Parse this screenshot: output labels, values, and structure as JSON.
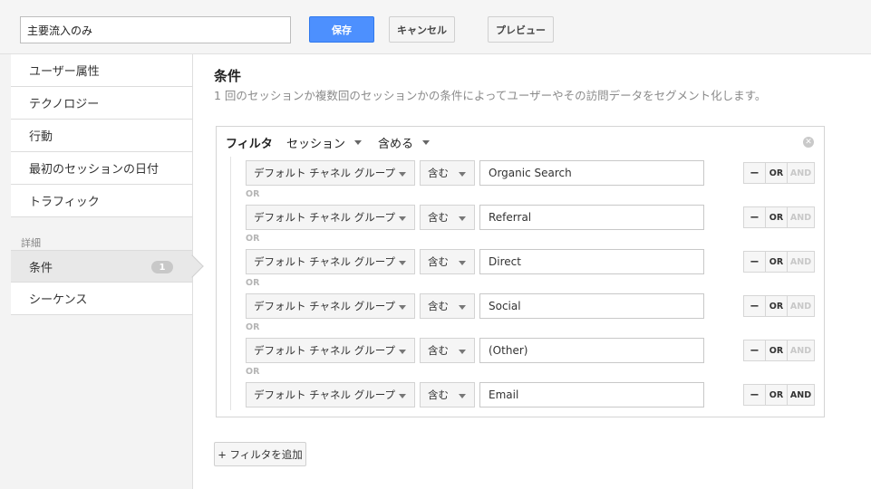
{
  "header": {
    "segment_name": "主要流入のみ",
    "save_label": "保存",
    "cancel_label": "キャンセル",
    "preview_label": "プレビュー"
  },
  "sidebar": {
    "items": [
      {
        "label": "ユーザー属性"
      },
      {
        "label": "テクノロジー"
      },
      {
        "label": "行動"
      },
      {
        "label": "最初のセッションの日付"
      },
      {
        "label": "トラフィック"
      }
    ],
    "section_label": "詳細",
    "advanced": [
      {
        "label": "条件",
        "badge": "1",
        "active": true
      },
      {
        "label": "シーケンス"
      }
    ]
  },
  "main": {
    "title": "条件",
    "description": "1 回のセッションか複数回のセッションかの条件によってユーザーやその訪問データをセグメント化します。",
    "filter": {
      "label": "フィルタ",
      "scope": "セッション",
      "mode": "含める",
      "or_separator": "OR",
      "rows": [
        {
          "dimension": "デフォルト チャネル グループ",
          "operator": "含む",
          "value": "Organic Search",
          "and_active": false
        },
        {
          "dimension": "デフォルト チャネル グループ",
          "operator": "含む",
          "value": "Referral",
          "and_active": false
        },
        {
          "dimension": "デフォルト チャネル グループ",
          "operator": "含む",
          "value": "Direct",
          "and_active": false
        },
        {
          "dimension": "デフォルト チャネル グループ",
          "operator": "含む",
          "value": "Social",
          "and_active": false
        },
        {
          "dimension": "デフォルト チャネル グループ",
          "operator": "含む",
          "value": "(Other)",
          "and_active": false
        },
        {
          "dimension": "デフォルト チャネル グループ",
          "operator": "含む",
          "value": "Email",
          "and_active": true
        }
      ],
      "minus_label": "−",
      "or_label": "OR",
      "and_label": "AND"
    },
    "add_filter_label": "+ フィルタを追加"
  }
}
